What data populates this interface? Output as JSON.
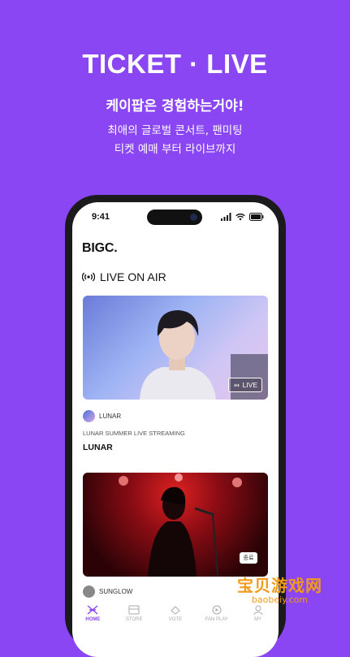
{
  "promo": {
    "headline": "TICKET · LIVE",
    "subhead": "케이팝은 경험하는거야!",
    "desc_line1": "최애의 글로벌 콘서트, 팬미팅",
    "desc_line2": "티켓 예매 부터 라이브까지"
  },
  "status_bar": {
    "time": "9:41"
  },
  "app": {
    "logo": "BIGC.",
    "section_title": "LIVE ON AIR",
    "cards": [
      {
        "artist": "LUNAR",
        "badge": "LIVE",
        "stream_label": "LUNAR SUMMER LIVE STREAMING",
        "stream_title": "LUNAR"
      },
      {
        "artist": "SUNGLOW"
      }
    ]
  },
  "tabs": [
    {
      "label": "HOME",
      "icon": "home-icon",
      "active": true
    },
    {
      "label": "STORE",
      "icon": "store-icon",
      "active": false
    },
    {
      "label": "VOTE",
      "icon": "vote-icon",
      "active": false
    },
    {
      "label": "FAN PLAY",
      "icon": "fanplay-icon",
      "active": false
    },
    {
      "label": "MY",
      "icon": "my-icon",
      "active": false
    }
  ],
  "watermark": {
    "brand": "宝贝游戏网",
    "url": "baobeiy.com",
    "chip": "종료"
  },
  "colors": {
    "accent": "#8a46f2",
    "watermark": "#f29a1c"
  }
}
